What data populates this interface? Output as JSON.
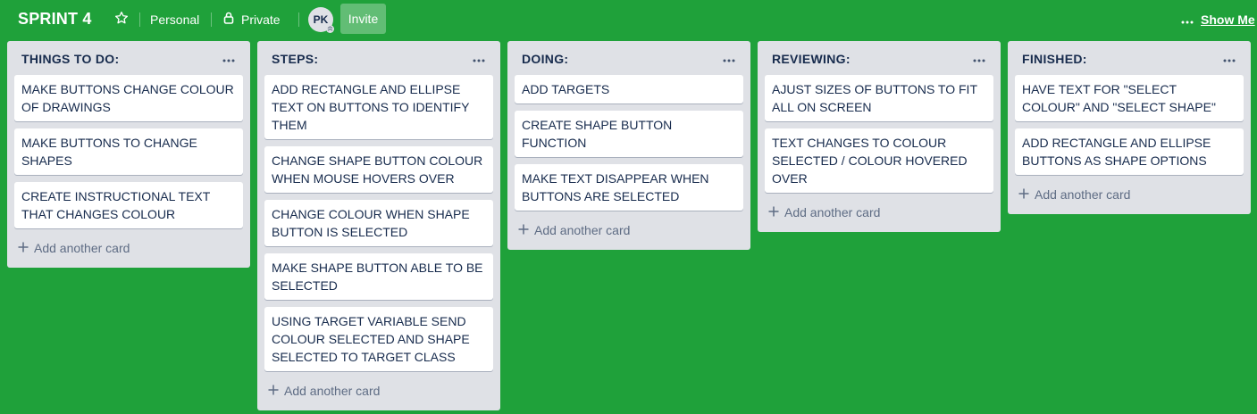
{
  "board": {
    "title": "SPRINT 4",
    "team_label": "Personal",
    "visibility_label": "Private",
    "member_initials": "PK",
    "invite_label": "Invite",
    "show_menu_label": "Show Me"
  },
  "colors": {
    "background": "#1fa13a",
    "list_bg": "#dfe1e6",
    "card_bg": "#ffffff",
    "text": "#172b4d",
    "muted": "#5e6c84"
  },
  "lists": [
    {
      "title": "THINGS TO DO:",
      "add_label": "Add another card",
      "cards": [
        "MAKE BUTTONS CHANGE COLOUR OF DRAWINGS",
        "MAKE BUTTONS TO CHANGE SHAPES",
        "CREATE INSTRUCTIONAL TEXT THAT CHANGES COLOUR"
      ]
    },
    {
      "title": "STEPS:",
      "add_label": "Add another card",
      "cards": [
        "ADD RECTANGLE AND ELLIPSE TEXT ON BUTTONS TO IDENTIFY THEM",
        "CHANGE SHAPE BUTTON COLOUR WHEN MOUSE HOVERS OVER",
        "CHANGE COLOUR WHEN SHAPE BUTTON IS SELECTED",
        "MAKE SHAPE BUTTON ABLE TO BE SELECTED",
        "USING TARGET VARIABLE SEND COLOUR SELECTED AND SHAPE SELECTED TO TARGET CLASS"
      ]
    },
    {
      "title": "DOING:",
      "add_label": "Add another card",
      "cards": [
        "ADD TARGETS",
        "CREATE SHAPE BUTTON FUNCTION",
        "MAKE TEXT DISAPPEAR WHEN BUTTONS ARE SELECTED"
      ]
    },
    {
      "title": "REVIEWING:",
      "add_label": "Add another card",
      "cards": [
        "AJUST SIZES OF BUTTONS TO FIT ALL ON SCREEN",
        "TEXT CHANGES TO COLOUR SELECTED / COLOUR HOVERED OVER"
      ]
    },
    {
      "title": "FINISHED:",
      "add_label": "Add another card",
      "cards": [
        "HAVE TEXT FOR \"SELECT COLOUR\" AND \"SELECT SHAPE\"",
        "ADD RECTANGLE AND ELLIPSE BUTTONS AS SHAPE OPTIONS"
      ]
    }
  ]
}
